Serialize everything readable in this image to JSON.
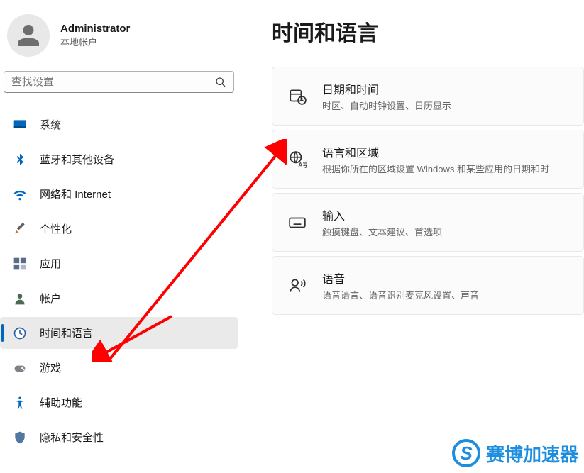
{
  "user": {
    "name": "Administrator",
    "subtitle": "本地帐户"
  },
  "search": {
    "placeholder": "查找设置"
  },
  "sidebar": {
    "items": [
      {
        "label": "系统"
      },
      {
        "label": "蓝牙和其他设备"
      },
      {
        "label": "网络和 Internet"
      },
      {
        "label": "个性化"
      },
      {
        "label": "应用"
      },
      {
        "label": "帐户"
      },
      {
        "label": "时间和语言"
      },
      {
        "label": "游戏"
      },
      {
        "label": "辅助功能"
      },
      {
        "label": "隐私和安全性"
      }
    ]
  },
  "page": {
    "title": "时间和语言"
  },
  "cards": [
    {
      "title": "日期和时间",
      "sub": "时区、自动时钟设置、日历显示"
    },
    {
      "title": "语言和区域",
      "sub": "根据你所在的区域设置 Windows 和某些应用的日期和时"
    },
    {
      "title": "输入",
      "sub": "触摸键盘、文本建议、首选项"
    },
    {
      "title": "语音",
      "sub": "语音语言、语音识别麦克风设置、声音"
    }
  ],
  "watermark": {
    "text": "赛博加速器",
    "initial": "S"
  }
}
